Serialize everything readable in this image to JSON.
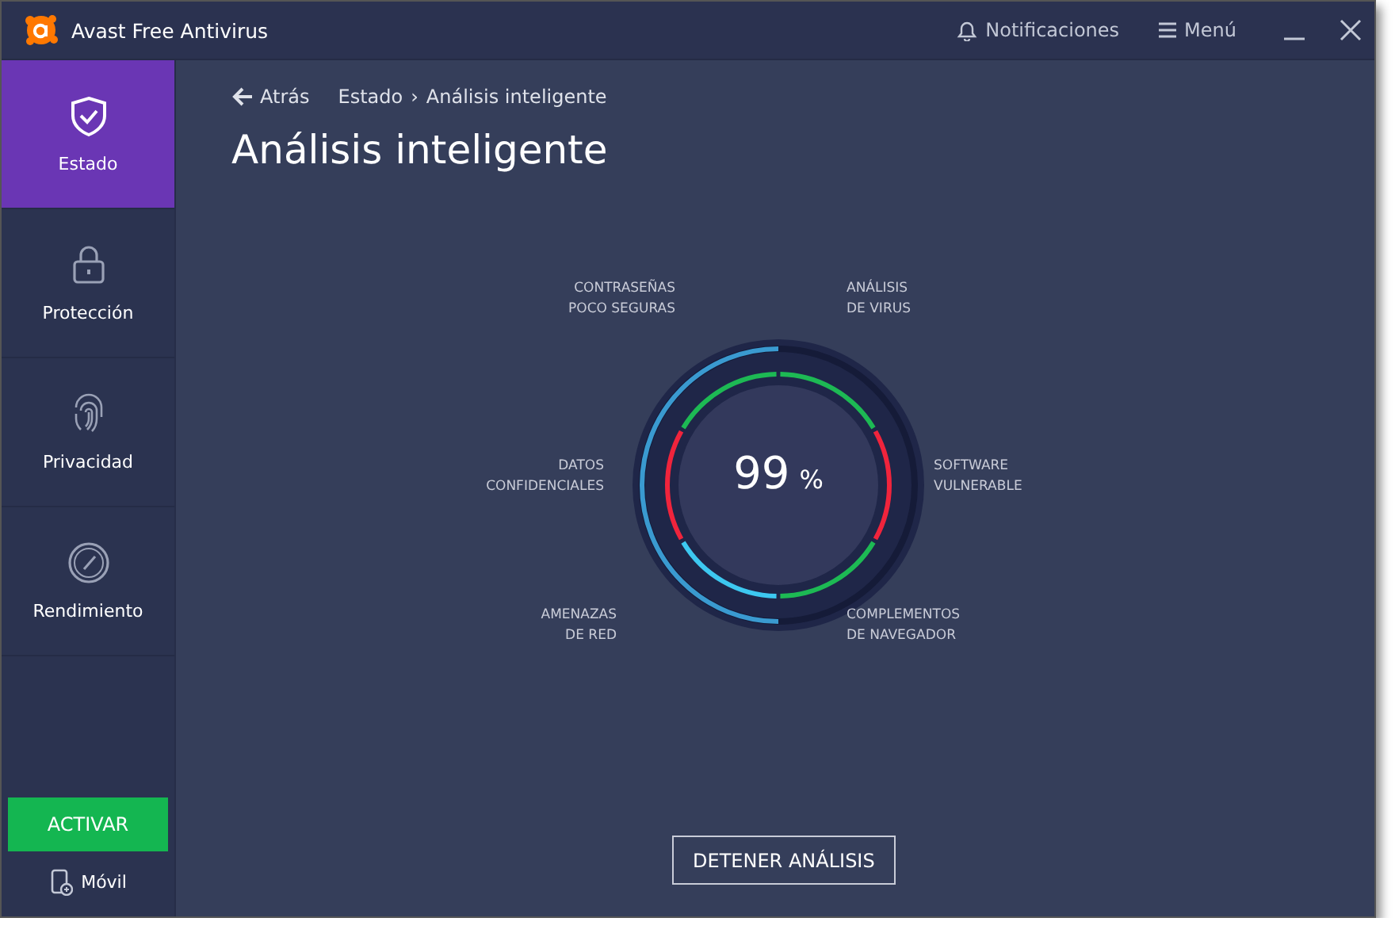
{
  "window": {
    "title": "Avast Free Antivirus"
  },
  "header": {
    "notifications": "Notificaciones",
    "menu": "Menú"
  },
  "sidebar": {
    "items": [
      {
        "label": "Estado",
        "selected": true
      },
      {
        "label": "Protección",
        "selected": false
      },
      {
        "label": "Privacidad",
        "selected": false
      },
      {
        "label": "Rendimiento",
        "selected": false
      }
    ],
    "activate_button": "ACTIVAR",
    "mobile": "Móvil"
  },
  "breadcrumb": {
    "back": "Atrás",
    "items": [
      "Estado",
      "Análisis inteligente"
    ],
    "separator": "›"
  },
  "page_title": "Análisis inteligente",
  "scan": {
    "percent": "99",
    "unit": "%",
    "categories": [
      {
        "label": "CONTRASEÑAS\nPOCO SEGURAS",
        "color": "#1db954"
      },
      {
        "label": "ANÁLISIS\nDE VIRUS",
        "color": "#1db954"
      },
      {
        "label": "DATOS\nCONFIDENCIALES",
        "color": "#f0243c"
      },
      {
        "label": "SOFTWARE\nVULNERABLE",
        "color": "#f0243c"
      },
      {
        "label": "AMENAZAS\nDE RED",
        "color": "#3dc8f0"
      },
      {
        "label": "COMPLEMENTOS\nDE NAVEGADOR",
        "color": "#1db954"
      }
    ]
  },
  "stop_button": "DETENER ANÁLISIS"
}
